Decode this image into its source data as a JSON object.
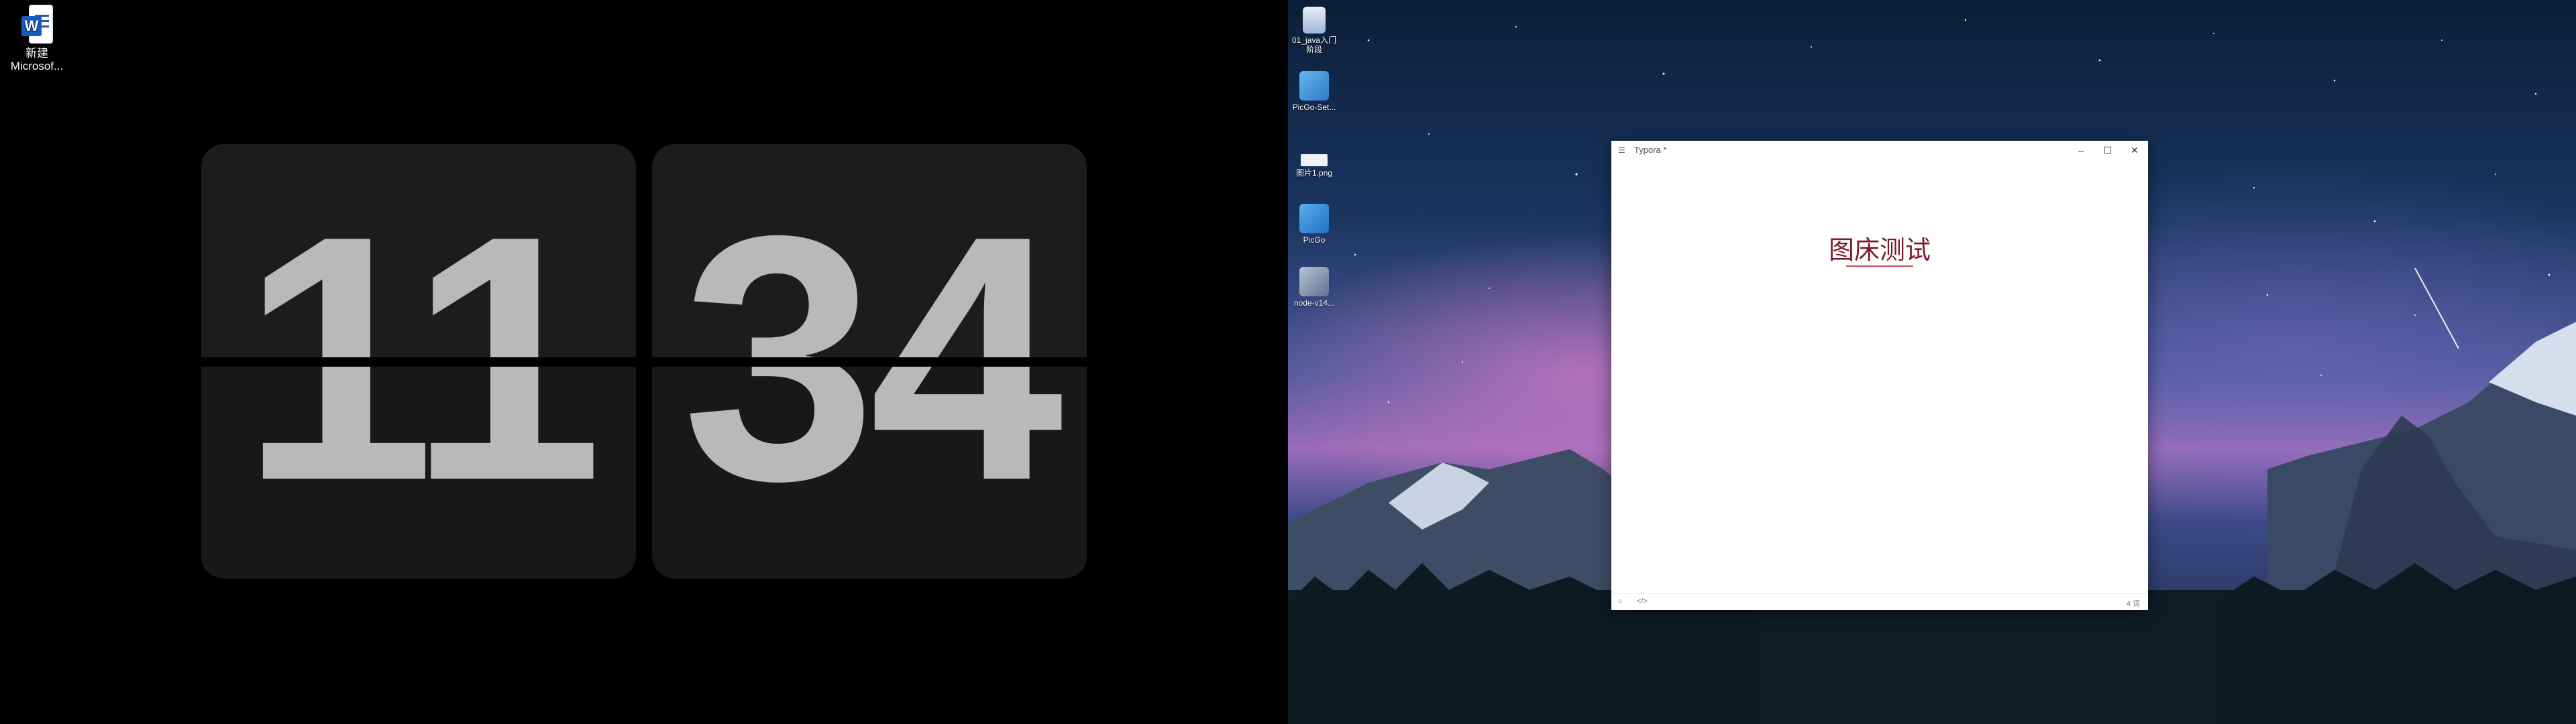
{
  "left_desktop": {
    "icons": [
      {
        "label": "新建\nMicrosof...",
        "icon": "word-document-icon"
      }
    ],
    "clock": {
      "hours": "11",
      "minutes": "34"
    }
  },
  "right_desktop": {
    "icons": [
      {
        "label": "01_java入门\n阶段",
        "icon": "folder-icon"
      },
      {
        "label": "PicGo-Set...",
        "icon": "installer-icon"
      },
      {
        "label": "图片1.png",
        "icon": "image-file-icon"
      },
      {
        "label": "PicGo",
        "icon": "picgo-icon"
      },
      {
        "label": "node-v14...",
        "icon": "setup-icon"
      }
    ]
  },
  "typora_window": {
    "title": "Typora *",
    "heading": "图床测试",
    "status": {
      "word_count": "4 词"
    }
  },
  "colors": {
    "heading_color": "#7b1c2c",
    "clock_digit": "#b9b9b9",
    "clock_card": "#1a1a1a"
  }
}
